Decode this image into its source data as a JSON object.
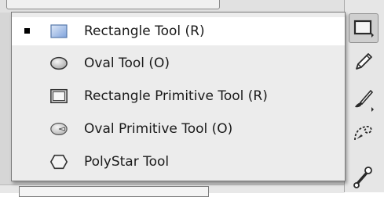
{
  "menu": {
    "items": [
      {
        "label": "Rectangle Tool (R)",
        "icon": "rectangle-icon",
        "selected": true
      },
      {
        "label": "Oval Tool (O)",
        "icon": "oval-icon",
        "selected": false
      },
      {
        "label": "Rectangle Primitive Tool (R)",
        "icon": "rectangle-primitive-icon",
        "selected": false
      },
      {
        "label": "Oval Primitive Tool (O)",
        "icon": "oval-primitive-icon",
        "selected": false
      },
      {
        "label": "PolyStar Tool",
        "icon": "polystar-icon",
        "selected": false
      }
    ]
  },
  "toolbar": {
    "tools": [
      {
        "icon": "rectangle-tool-icon",
        "active": true
      },
      {
        "icon": "pencil-icon",
        "active": false
      },
      {
        "icon": "brush-icon",
        "active": false
      },
      {
        "icon": "deco-icon",
        "active": false
      },
      {
        "icon": "bone-icon",
        "active": false
      }
    ]
  },
  "colors": {
    "menu_background": "#ececec",
    "selected_background": "#ffffff",
    "rectangle_fill": "#9fbbe6"
  }
}
